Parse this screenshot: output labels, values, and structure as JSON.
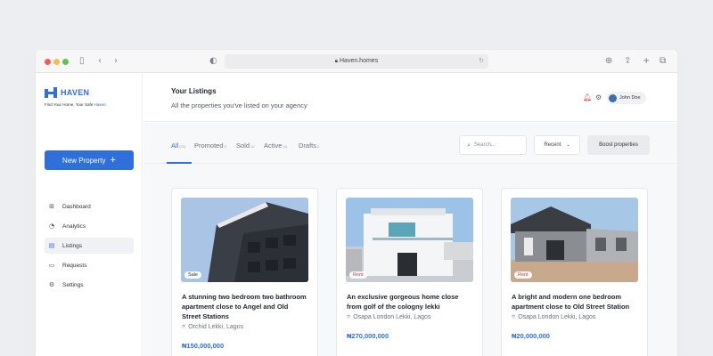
{
  "browser": {
    "url": "Haven.homes",
    "icons": [
      "sidebar-toggle-icon",
      "back-icon",
      "forward-icon",
      "shield-icon",
      "download-icon",
      "share-icon",
      "new-tab-icon",
      "tabs-icon"
    ]
  },
  "brand": {
    "name": "HAVEN",
    "tagline_prefix": "Find Your Home, Your Safe ",
    "tagline_accent": "Haven.",
    "color": "#2f6fd9"
  },
  "sidebar": {
    "new_property_label": "New Property",
    "items": [
      {
        "label": "Dashboard",
        "icon": "grid-icon",
        "active": false
      },
      {
        "label": "Analytics",
        "icon": "chart-icon",
        "active": false
      },
      {
        "label": "Listings",
        "icon": "document-icon",
        "active": true
      },
      {
        "label": "Requests",
        "icon": "inbox-icon",
        "active": false
      },
      {
        "label": "Settings",
        "icon": "gear-icon",
        "active": false
      }
    ]
  },
  "header": {
    "title": "Your Listings",
    "subtitle": "All the properties you've listed on your agency",
    "user_name": "John Doe"
  },
  "tabs": [
    {
      "label": "All",
      "count": "(23)",
      "active": true
    },
    {
      "label": "Promoted",
      "count": "8",
      "active": false
    },
    {
      "label": "Sold",
      "count": "10",
      "active": false
    },
    {
      "label": "Active",
      "count": "(3)",
      "active": false
    },
    {
      "label": "Drafts",
      "count": "2",
      "active": false
    }
  ],
  "toolbar": {
    "search_placeholder": "Search...",
    "sort_value": "Recent",
    "boost_label": "Boost properties"
  },
  "listings": [
    {
      "badge": "Sale",
      "title": "A stunning two bedroom two bathroom apartment close to Angel and Old Street Stations",
      "location": "Orchid Lekki, Lagos",
      "price": "₦150,000,000"
    },
    {
      "badge": "Rent",
      "title": "An exclusive gorgeous home close from golf of the cologny lekki",
      "location": "Osapa London Lekki, Lagos",
      "price": "₦270,000,000"
    },
    {
      "badge": "Rent",
      "title": "A bright and modern one bedroom apartment close to Old Street Station",
      "location": "Osapa London Lekki, Lagos",
      "price": "₦20,000,000"
    }
  ]
}
